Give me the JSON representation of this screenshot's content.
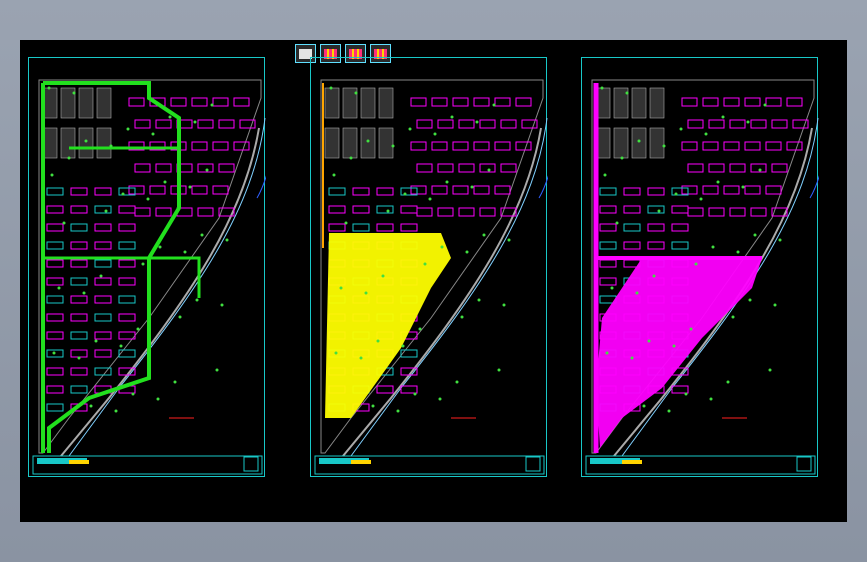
{
  "app": {
    "title": ""
  },
  "toolbar": {
    "icons": [
      "layer-icon",
      "drawing-icon",
      "drawing-icon",
      "drawing-icon",
      "drawing-icon"
    ]
  },
  "sheets": [
    {
      "id": "sheet-1",
      "highlight": "#22e01e",
      "mode": "outline"
    },
    {
      "id": "sheet-2",
      "highlight": "#ffff00",
      "mode": "fill-south"
    },
    {
      "id": "sheet-3",
      "highlight": "#ff00ff",
      "mode": "fill-east"
    }
  ],
  "colors": {
    "background": "#000000",
    "frame": "#18c8c8",
    "building": "#ff00ff",
    "road": "#aaaaaa",
    "tree": "#40e040",
    "annotation": "#ffd400"
  }
}
